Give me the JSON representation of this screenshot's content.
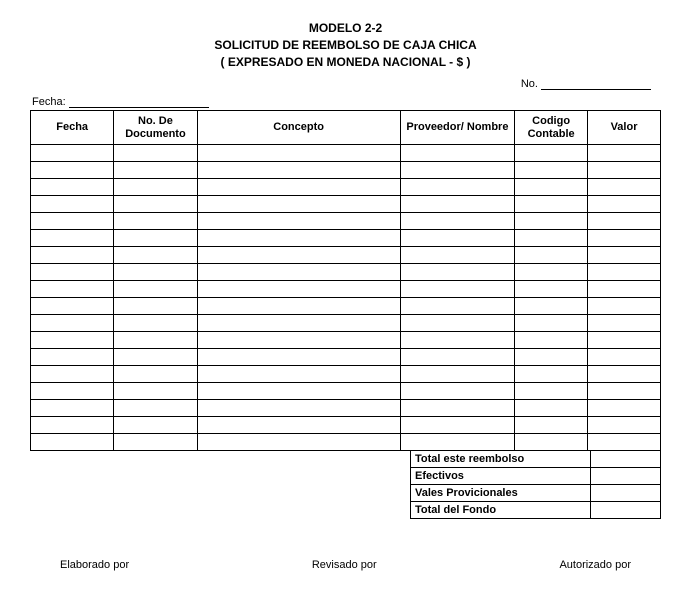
{
  "header": {
    "line1": "MODELO 2-2",
    "line2": "SOLICITUD DE REEMBOLSO DE CAJA CHICA",
    "line3": "( EXPRESADO EN MONEDA NACIONAL - $ )"
  },
  "no_label": "No.",
  "no_value": "",
  "fecha_label": "Fecha:",
  "fecha_value": "",
  "columns": {
    "fecha": "Fecha",
    "doc": "No. De Documento",
    "concepto": "Concepto",
    "proveedor": "Proveedor/ Nombre",
    "codigo": "Codigo Contable",
    "valor": "Valor"
  },
  "rows": [
    {
      "fecha": "",
      "doc": "",
      "concepto": "",
      "prov": "",
      "cod": "",
      "valor": ""
    },
    {
      "fecha": "",
      "doc": "",
      "concepto": "",
      "prov": "",
      "cod": "",
      "valor": ""
    },
    {
      "fecha": "",
      "doc": "",
      "concepto": "",
      "prov": "",
      "cod": "",
      "valor": ""
    },
    {
      "fecha": "",
      "doc": "",
      "concepto": "",
      "prov": "",
      "cod": "",
      "valor": ""
    },
    {
      "fecha": "",
      "doc": "",
      "concepto": "",
      "prov": "",
      "cod": "",
      "valor": ""
    },
    {
      "fecha": "",
      "doc": "",
      "concepto": "",
      "prov": "",
      "cod": "",
      "valor": ""
    },
    {
      "fecha": "",
      "doc": "",
      "concepto": "",
      "prov": "",
      "cod": "",
      "valor": ""
    },
    {
      "fecha": "",
      "doc": "",
      "concepto": "",
      "prov": "",
      "cod": "",
      "valor": ""
    },
    {
      "fecha": "",
      "doc": "",
      "concepto": "",
      "prov": "",
      "cod": "",
      "valor": ""
    },
    {
      "fecha": "",
      "doc": "",
      "concepto": "",
      "prov": "",
      "cod": "",
      "valor": ""
    },
    {
      "fecha": "",
      "doc": "",
      "concepto": "",
      "prov": "",
      "cod": "",
      "valor": ""
    },
    {
      "fecha": "",
      "doc": "",
      "concepto": "",
      "prov": "",
      "cod": "",
      "valor": ""
    },
    {
      "fecha": "",
      "doc": "",
      "concepto": "",
      "prov": "",
      "cod": "",
      "valor": ""
    },
    {
      "fecha": "",
      "doc": "",
      "concepto": "",
      "prov": "",
      "cod": "",
      "valor": ""
    },
    {
      "fecha": "",
      "doc": "",
      "concepto": "",
      "prov": "",
      "cod": "",
      "valor": ""
    },
    {
      "fecha": "",
      "doc": "",
      "concepto": "",
      "prov": "",
      "cod": "",
      "valor": ""
    },
    {
      "fecha": "",
      "doc": "",
      "concepto": "",
      "prov": "",
      "cod": "",
      "valor": ""
    },
    {
      "fecha": "",
      "doc": "",
      "concepto": "",
      "prov": "",
      "cod": "",
      "valor": ""
    }
  ],
  "summary": {
    "total_reembolso": {
      "label": "Total este reembolso",
      "value": ""
    },
    "efectivos": {
      "label": "Efectivos",
      "value": ""
    },
    "vales": {
      "label": "Vales Provicionales",
      "value": ""
    },
    "total_fondo": {
      "label": "Total del Fondo",
      "value": ""
    }
  },
  "signatures": {
    "elaborado": "Elaborado por",
    "revisado": "Revisado por",
    "autorizado": "Autorizado por"
  }
}
